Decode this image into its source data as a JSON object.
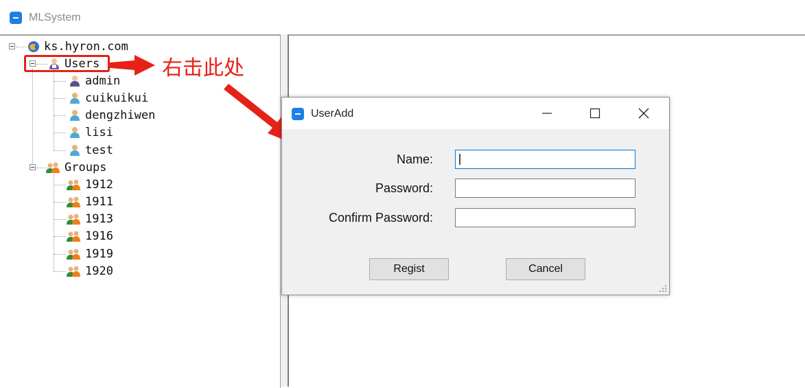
{
  "app": {
    "title": "MLSystem",
    "icon": "app-window-icon",
    "accent": "#1e7fe6"
  },
  "tree": {
    "root": {
      "label": "ks.hyron.com",
      "icon": "domain-globe-icon"
    },
    "users": {
      "label": "Users",
      "icon": "users-folder-icon",
      "items": [
        {
          "label": "admin",
          "icon": "admin-user-icon"
        },
        {
          "label": "cuikuikui",
          "icon": "user-icon"
        },
        {
          "label": "dengzhiwen",
          "icon": "user-icon"
        },
        {
          "label": "lisi",
          "icon": "user-icon"
        },
        {
          "label": "test",
          "icon": "user-icon"
        }
      ]
    },
    "groups": {
      "label": "Groups",
      "icon": "group-icon",
      "items": [
        {
          "label": "1912",
          "icon": "group-icon"
        },
        {
          "label": "1911",
          "icon": "group-icon"
        },
        {
          "label": "1913",
          "icon": "group-icon"
        },
        {
          "label": "1916",
          "icon": "group-icon"
        },
        {
          "label": "1919",
          "icon": "group-icon"
        },
        {
          "label": "1920",
          "icon": "group-icon"
        }
      ]
    }
  },
  "annotation": {
    "text": "右击此处",
    "color": "#e62117"
  },
  "dialog": {
    "title": "UserAdd",
    "fields": {
      "name": {
        "label": "Name:",
        "value": ""
      },
      "password": {
        "label": "Password:",
        "value": ""
      },
      "confirm": {
        "label": "Confirm Password:",
        "value": ""
      }
    },
    "buttons": {
      "regist": "Regist",
      "cancel": "Cancel"
    },
    "focus_color": "#0078d7"
  }
}
